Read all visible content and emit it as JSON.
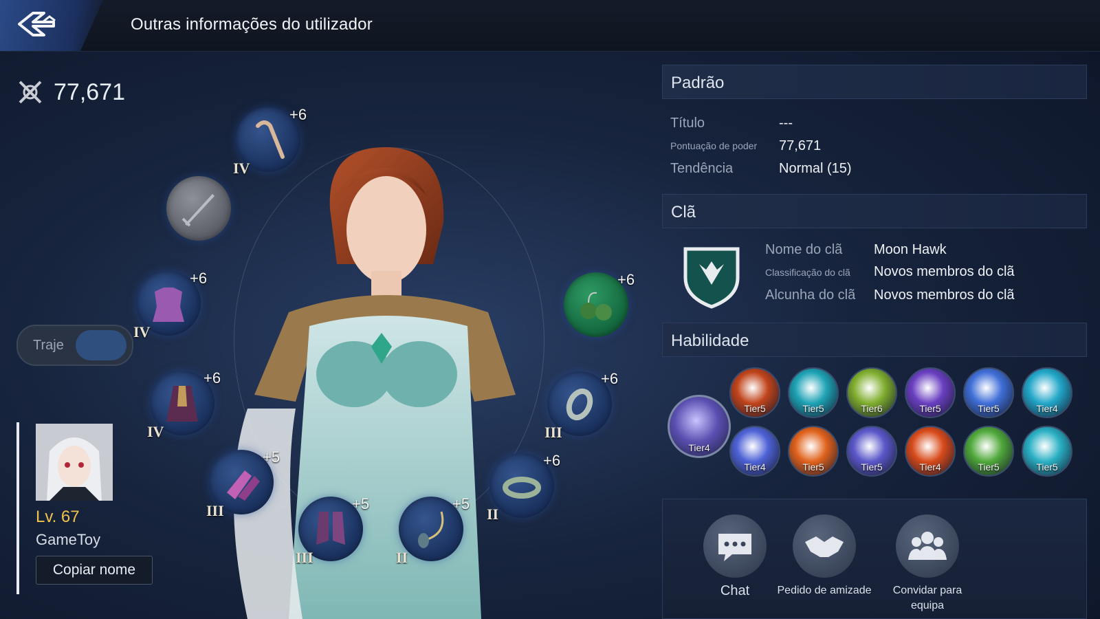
{
  "header": {
    "title": "Outras informações do utilizador"
  },
  "power": {
    "value": "77,671"
  },
  "costume": {
    "label": "Traje"
  },
  "equipment": [
    {
      "name": "staff",
      "plus": "+6",
      "grade": "IV"
    },
    {
      "name": "weapon-empty",
      "plus": "",
      "grade": ""
    },
    {
      "name": "armor",
      "plus": "+6",
      "grade": "IV"
    },
    {
      "name": "cloak",
      "plus": "+6",
      "grade": "IV"
    },
    {
      "name": "gloves",
      "plus": "+5",
      "grade": "III"
    },
    {
      "name": "boots",
      "plus": "+5",
      "grade": "III"
    },
    {
      "name": "necklace",
      "plus": "+5",
      "grade": "II"
    },
    {
      "name": "bracelet",
      "plus": "+6",
      "grade": "II"
    },
    {
      "name": "ring",
      "plus": "+6",
      "grade": "III"
    },
    {
      "name": "earrings",
      "plus": "+6",
      "grade": ""
    }
  ],
  "player": {
    "level": "Lv. 67",
    "name": "GameToy",
    "copy_label": "Copiar nome"
  },
  "standard": {
    "header": "Padrão",
    "title_label": "Título",
    "title_value": "---",
    "power_label": "Pontuação de poder",
    "power_value": "77,671",
    "tendency_label": "Tendência",
    "tendency_value": "Normal (15)"
  },
  "clan": {
    "header": "Clã",
    "name_label": "Nome do clã",
    "name_value": "Moon Hawk",
    "rank_label": "Classificação do clã",
    "rank_value": "Novos membros do clã",
    "nick_label": "Alcunha do clã",
    "nick_value": "Novos membros do clã"
  },
  "skills": {
    "header": "Habilidade",
    "main": {
      "tier": "Tier4",
      "color": "#5a4fb0"
    },
    "items": [
      {
        "tier": "Tier5",
        "color": "#c0441b"
      },
      {
        "tier": "Tier5",
        "color": "#1ea3b5"
      },
      {
        "tier": "Tier6",
        "color": "#7fae2e"
      },
      {
        "tier": "Tier5",
        "color": "#6a3fc0"
      },
      {
        "tier": "Tier5",
        "color": "#3f6fd8"
      },
      {
        "tier": "Tier4",
        "color": "#22a7c9"
      },
      {
        "tier": "Tier4",
        "color": "#4e62d6"
      },
      {
        "tier": "Tier5",
        "color": "#e0621c"
      },
      {
        "tier": "Tier5",
        "color": "#5b57c9"
      },
      {
        "tier": "Tier4",
        "color": "#d84a1a"
      },
      {
        "tier": "Tier5",
        "color": "#4fa83a"
      },
      {
        "tier": "Tier5",
        "color": "#2ab0c4"
      }
    ]
  },
  "actions": {
    "chat": "Chat",
    "friend": "Pedido de amizade",
    "invite": "Convidar para equipa"
  }
}
